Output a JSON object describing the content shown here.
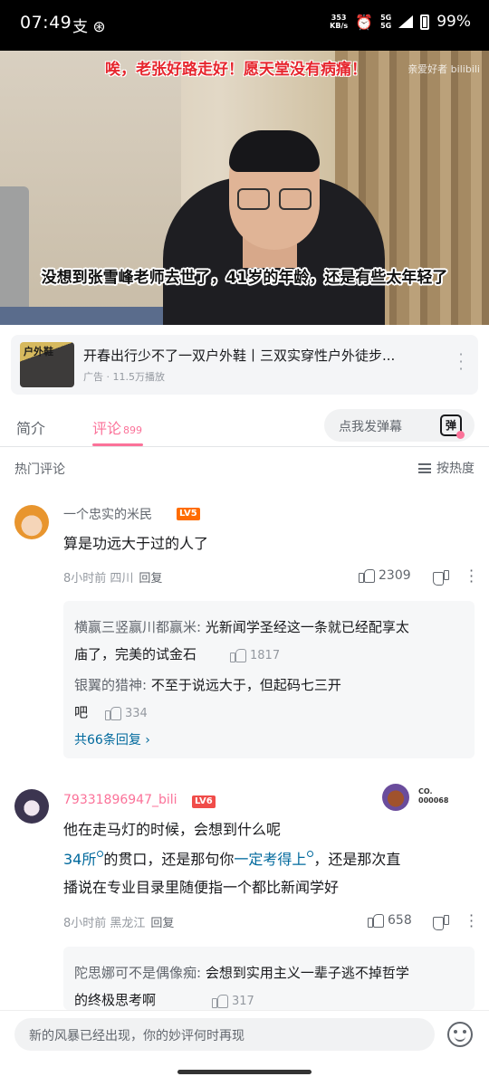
{
  "status_bar": {
    "time": "07:49",
    "left_icons": "支 ⊛",
    "speed_value": "353",
    "speed_unit": "KB/s",
    "network": "5G",
    "network2": "5G",
    "battery": "99%"
  },
  "video": {
    "danmaku": "唉，老张好路走好！愿天堂没有病痛！",
    "watermark": "亲爱好者 bilibili",
    "subtitle": "没想到张雪峰老师去世了，41岁的年龄，还是有些太年轻了"
  },
  "ad": {
    "thumb_text": "户外鞋",
    "title": "开春出行少不了一双户外鞋丨三双实穿性户外徒步...",
    "subtitle": "广告 · 11.5万播放"
  },
  "tabs": {
    "intro": "简介",
    "comments": "评论",
    "comments_count": "899",
    "danmu_placeholder": "点我发弹幕",
    "danmu_icon": "弹"
  },
  "sort": {
    "label": "热门评论",
    "button": "按热度"
  },
  "comments": [
    {
      "username": "一个忠实的米民",
      "level": "LV5",
      "content": "算是功远大于过的人了",
      "time": "8小时前 四川",
      "reply_label": "回复",
      "likes": "2309",
      "replies": [
        {
          "name": "横赢三竖赢川都赢米:",
          "text_line1": "光新闻学圣经这一条就已经配享太",
          "text_line2": "庙了，完美的试金石",
          "likes": "1817"
        },
        {
          "name": "银翼的猎神:",
          "text_line1": "不至于说远大于，但起码七三开",
          "text_line2": "吧",
          "likes": "334"
        }
      ],
      "more_replies": "共66条回复 ›"
    },
    {
      "username": "79331896947_bili",
      "level": "LV6",
      "decoration_text": "CO.\n000068",
      "content_line1": "他在走马灯的时候，会想到什么呢",
      "link1": "34所",
      "content_mid": "的贯口，还是那句你",
      "link2": "一定考得上",
      "content_end": "，还是那次直",
      "content_line3": "播说在专业目录里随便指一个都比新闻学好",
      "time": "8小时前 黑龙江",
      "reply_label": "回复",
      "likes": "658",
      "replies": [
        {
          "name": "陀思娜可不是偶像痴:",
          "text_line1": "会想到实用主义一辈子逃不掉哲学",
          "text_line2": "的终极思考啊",
          "likes": "317"
        }
      ]
    }
  ],
  "bottom": {
    "placeholder": "新的风暴已经出现，你的妙评何时再现"
  }
}
